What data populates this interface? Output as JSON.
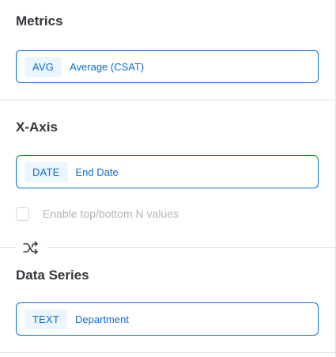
{
  "metrics": {
    "title": "Metrics",
    "field": {
      "type": "AVG",
      "label": "Average (CSAT)"
    }
  },
  "xaxis": {
    "title": "X-Axis",
    "field": {
      "type": "DATE",
      "label": "End Date"
    },
    "checkbox_label": "Enable top/bottom N values"
  },
  "swap": {
    "icon": "shuffle-swap-icon"
  },
  "data_series": {
    "title": "Data Series",
    "field": {
      "type": "TEXT",
      "label": "Department"
    }
  },
  "colors": {
    "accent": "#0a6ed1",
    "chip_bg": "#ebf5fe",
    "divider": "#e5e5e5",
    "disabled_text": "#b3b5b8"
  }
}
